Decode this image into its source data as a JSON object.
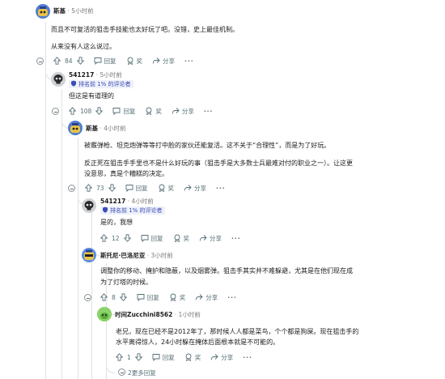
{
  "comments": [
    {
      "author": "斯基",
      "time": "5小时前",
      "lines": [
        "而且不可复活的狙击手技能也太好玩了吧。没错，史上最佳机制。",
        "从来没有人这么说过。"
      ],
      "votes": "84",
      "reply_label": "回复",
      "award_label": "奖",
      "share_label": "分享",
      "more_label": "···"
    },
    {
      "author": "541217",
      "time": "5小时前",
      "badge": "排名前 1% 的评论者",
      "lines": [
        "但这是有道理的"
      ],
      "votes": "108",
      "reply_label": "回复",
      "award_label": "奖",
      "share_label": "分享",
      "more_label": "···"
    },
    {
      "author": "斯基",
      "time": "4小时前",
      "lines": [
        "被霰弹枪、坦克炮弹等等打中脸的家伙还能复活。这不关于“合理性”，而是为了好玩。",
        "反正死在狙击手手里也不是什么好玩的事（狙击手是大多数士兵最难对付的职业之一）。让这更",
        "没意思，真是个糟糕的决定。"
      ],
      "votes": "73",
      "reply_label": "回复",
      "award_label": "奖",
      "share_label": "分享",
      "more_label": "···"
    },
    {
      "author": "541217",
      "time": "4小时前",
      "badge": "排名前 1% 的评论者",
      "lines": [
        "是的，我想"
      ],
      "votes": "12",
      "reply_label": "回复",
      "award_label": "奖",
      "share_label": "分享",
      "more_label": "···"
    },
    {
      "author": "斯托尼·巴洛尼亚",
      "time": "3小时前",
      "lines": [
        "调整你的移动、掩护和隐蔽，以及烟雾弹。狙击手其实并不难躲避，尤其是在他们现在成",
        "为了灯塔的时候。"
      ],
      "votes": "8",
      "reply_label": "回复",
      "award_label": "奖",
      "share_label": "分享",
      "more_label": "···"
    },
    {
      "author": "时间Zucchini8562",
      "time": "1小时前",
      "lines": [
        "老兄，现在已经不是2012年了，那时候人人都是菜鸟，个个都是狗屎。现在狙击手的",
        "水平离得惊人，24小时躲在掩体后面根本就是不可能的。"
      ],
      "votes": "1",
      "reply_label": "回复",
      "award_label": "奖",
      "share_label": "分享",
      "more_label": "···"
    }
  ],
  "more_replies": "2更多回复"
}
